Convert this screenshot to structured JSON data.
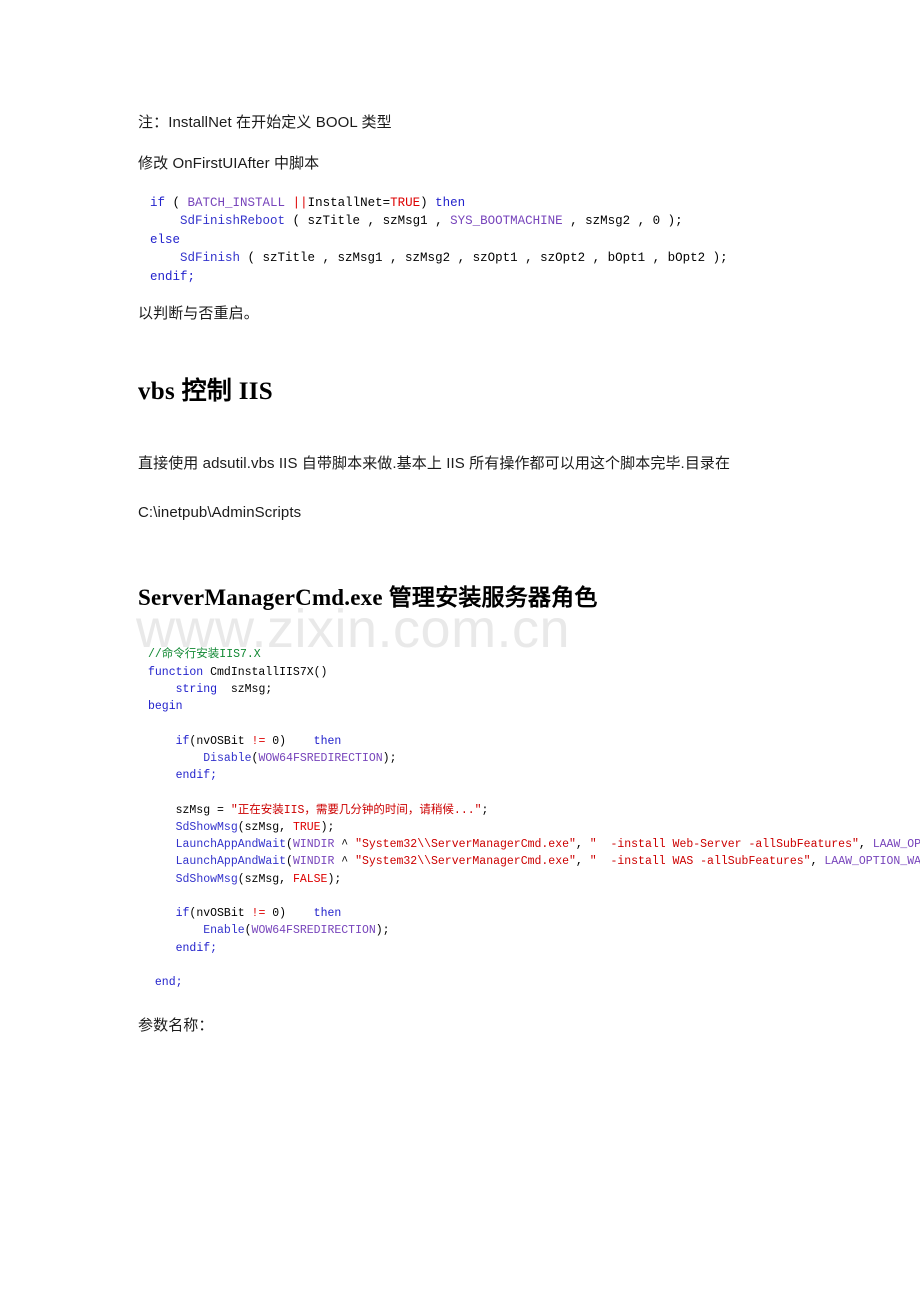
{
  "document": {
    "watermark": "www.zixin.com.cn",
    "blocks": [
      {
        "kind": "paragraph",
        "id": "note-installnet",
        "text": "注：InstallNet 在开始定义 BOOL 类型"
      },
      {
        "kind": "paragraph",
        "id": "modify-onfirstuiafter",
        "text": "修改 OnFirstUIAfter 中脚本"
      },
      {
        "kind": "paragraph",
        "id": "judge-reboot",
        "text": "以判断与否重启。"
      },
      {
        "kind": "heading",
        "id": "heading-vbs-iis",
        "text": "vbs 控制 IIS"
      },
      {
        "kind": "paragraph",
        "id": "adsutil-desc-line1",
        "text": "直接使用 adsutil.vbs IIS 自带脚本来做.基本上 IIS 所有操作都可以用这个脚本完毕.目录在"
      },
      {
        "kind": "paragraph",
        "id": "adsutil-desc-line2",
        "text": "C:\\inetpub\\AdminScripts"
      },
      {
        "kind": "heading",
        "id": "heading-servermanagercmd",
        "text": "ServerManagerCmd.exe  管理安装服务器角色"
      },
      {
        "kind": "paragraph",
        "id": "param-name-label",
        "text": "参数名称："
      }
    ],
    "paragraphs": {
      "note_installnet": "注：InstallNet 在开始定义 BOOL 类型",
      "modify_onfirstuiafter": "修改 OnFirstUIAfter 中脚本",
      "judge_reboot": "以判断与否重启。",
      "adsutil_line1": "直接使用 adsutil.vbs IIS 自带脚本来做.基本上 IIS 所有操作都可以用这个脚本完毕.目录在",
      "adsutil_line2": "C:\\inetpub\\AdminScripts",
      "param_name_label": "参数名称："
    },
    "headings": {
      "vbs_iis": "vbs 控制 IIS",
      "server_manager_cmd": "ServerManagerCmd.exe  管理安装服务器角色"
    },
    "code_block_1": {
      "id": "installscript-finish-reboot",
      "lines": [
        [
          {
            "t": "if",
            "c": "kw"
          },
          {
            "t": " ( ",
            "c": "pln"
          },
          {
            "t": "BATCH_INSTALL",
            "c": "cst"
          },
          {
            "t": " ",
            "c": "pln"
          },
          {
            "t": "||",
            "c": "op"
          },
          {
            "t": "InstallNet=",
            "c": "pln"
          },
          {
            "t": "TRUE",
            "c": "op"
          },
          {
            "t": ") ",
            "c": "pln"
          },
          {
            "t": "then",
            "c": "kw"
          }
        ],
        [
          {
            "t": "    ",
            "c": "pln"
          },
          {
            "t": "SdFinishReboot",
            "c": "fn"
          },
          {
            "t": " ( szTitle , szMsg1 , ",
            "c": "pln"
          },
          {
            "t": "SYS_BOOTMACHINE",
            "c": "cst"
          },
          {
            "t": " , szMsg2 , 0 );",
            "c": "pln"
          }
        ],
        [
          {
            "t": "else",
            "c": "kw"
          }
        ],
        [
          {
            "t": "    ",
            "c": "pln"
          },
          {
            "t": "SdFinish",
            "c": "fn"
          },
          {
            "t": " ( szTitle , szMsg1 , szMsg2 , szOpt1 , szOpt2 , bOpt1 , bOpt2 );",
            "c": "pln"
          }
        ],
        [
          {
            "t": "endif;",
            "c": "kw"
          }
        ]
      ]
    },
    "code_block_2": {
      "id": "cmd-install-iis7x",
      "lines": [
        [
          {
            "t": "//命令行安装IIS7.X",
            "c": "cmt"
          }
        ],
        [
          {
            "t": "function",
            "c": "kw"
          },
          {
            "t": " CmdInstallIIS7X()",
            "c": "pln"
          }
        ],
        [
          {
            "t": "    ",
            "c": "pln"
          },
          {
            "t": "string",
            "c": "kw"
          },
          {
            "t": "  szMsg;",
            "c": "pln"
          }
        ],
        [
          {
            "t": "begin",
            "c": "kw"
          }
        ],
        [
          {
            "t": "",
            "c": "pln"
          }
        ],
        [
          {
            "t": "    ",
            "c": "pln"
          },
          {
            "t": "if",
            "c": "kw"
          },
          {
            "t": "(nvOSBit ",
            "c": "pln"
          },
          {
            "t": "!=",
            "c": "op"
          },
          {
            "t": " 0)    ",
            "c": "pln"
          },
          {
            "t": "then",
            "c": "kw"
          }
        ],
        [
          {
            "t": "        ",
            "c": "pln"
          },
          {
            "t": "Disable",
            "c": "fn"
          },
          {
            "t": "(",
            "c": "pln"
          },
          {
            "t": "WOW64FSREDIRECTION",
            "c": "cst"
          },
          {
            "t": ");",
            "c": "pln"
          }
        ],
        [
          {
            "t": "    ",
            "c": "pln"
          },
          {
            "t": "endif;",
            "c": "kw"
          }
        ],
        [
          {
            "t": "",
            "c": "pln"
          }
        ],
        [
          {
            "t": "    szMsg = ",
            "c": "pln"
          },
          {
            "t": "\"正在安装IIS，需要几分钟的时间，请稍候...\"",
            "c": "str"
          },
          {
            "t": ";",
            "c": "pln"
          }
        ],
        [
          {
            "t": "    ",
            "c": "pln"
          },
          {
            "t": "SdShowMsg",
            "c": "fn"
          },
          {
            "t": "(szMsg, ",
            "c": "pln"
          },
          {
            "t": "TRUE",
            "c": "op"
          },
          {
            "t": ");",
            "c": "pln"
          }
        ],
        [
          {
            "t": "    ",
            "c": "pln"
          },
          {
            "t": "LaunchAppAndWait",
            "c": "fn"
          },
          {
            "t": "(",
            "c": "pln"
          },
          {
            "t": "WINDIR",
            "c": "cst"
          },
          {
            "t": " ^ ",
            "c": "pln"
          },
          {
            "t": "\"System32\\\\ServerManagerCmd.exe\"",
            "c": "str"
          },
          {
            "t": ", ",
            "c": "pln"
          },
          {
            "t": "\"  -install Web-Server -allSubFeatures\"",
            "c": "str"
          },
          {
            "t": ", ",
            "c": "pln"
          },
          {
            "t": "LAAW_OPTION_WAIT",
            "c": "cst"
          }
        ],
        [
          {
            "t": "    ",
            "c": "pln"
          },
          {
            "t": "LaunchAppAndWait",
            "c": "fn"
          },
          {
            "t": "(",
            "c": "pln"
          },
          {
            "t": "WINDIR",
            "c": "cst"
          },
          {
            "t": " ^ ",
            "c": "pln"
          },
          {
            "t": "\"System32\\\\ServerManagerCmd.exe\"",
            "c": "str"
          },
          {
            "t": ", ",
            "c": "pln"
          },
          {
            "t": "\"  -install WAS -allSubFeatures\"",
            "c": "str"
          },
          {
            "t": ", ",
            "c": "pln"
          },
          {
            "t": "LAAW_OPTION_WAIT",
            "c": "cst"
          }
        ],
        [
          {
            "t": "    ",
            "c": "pln"
          },
          {
            "t": "SdShowMsg",
            "c": "fn"
          },
          {
            "t": "(szMsg, ",
            "c": "pln"
          },
          {
            "t": "FALSE",
            "c": "op"
          },
          {
            "t": ");",
            "c": "pln"
          }
        ],
        [
          {
            "t": "",
            "c": "pln"
          }
        ],
        [
          {
            "t": "    ",
            "c": "pln"
          },
          {
            "t": "if",
            "c": "kw"
          },
          {
            "t": "(nvOSBit ",
            "c": "pln"
          },
          {
            "t": "!=",
            "c": "op"
          },
          {
            "t": " 0)    ",
            "c": "pln"
          },
          {
            "t": "then",
            "c": "kw"
          }
        ],
        [
          {
            "t": "        ",
            "c": "pln"
          },
          {
            "t": "Enable",
            "c": "fn"
          },
          {
            "t": "(",
            "c": "pln"
          },
          {
            "t": "WOW64FSREDIRECTION",
            "c": "cst"
          },
          {
            "t": ");",
            "c": "pln"
          }
        ],
        [
          {
            "t": "    ",
            "c": "pln"
          },
          {
            "t": "endif;",
            "c": "kw"
          }
        ],
        [
          {
            "t": "",
            "c": "pln"
          }
        ],
        [
          {
            "t": " ",
            "c": "pln"
          },
          {
            "t": "end;",
            "c": "kw"
          }
        ]
      ]
    },
    "colors": {
      "keyword": "#2222cc",
      "function": "#3333cc",
      "constant": "#7744bb",
      "operator": "#dd0000",
      "string": "#cc0000",
      "comment": "#118833",
      "plain": "#000000",
      "watermark": "#e9e9e9",
      "page_background": "#ffffff",
      "body_text": "#1b1b1b"
    }
  }
}
